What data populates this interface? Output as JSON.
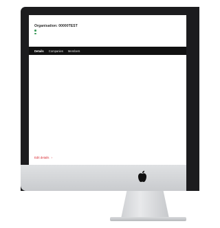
{
  "organisation": {
    "title": "Organisation: 00000TEST",
    "links": [
      "",
      ""
    ]
  },
  "tabs": [
    {
      "label": "Details",
      "active": true
    },
    {
      "label": "Companies",
      "active": false
    },
    {
      "label": "Members",
      "active": false
    },
    {
      "label": "",
      "active": false
    }
  ],
  "details": [
    {
      "label": "",
      "value": ""
    },
    {
      "label": "",
      "value": ""
    },
    {
      "label": "",
      "value": ""
    },
    {
      "label": "",
      "value": ""
    },
    {
      "label": "",
      "value": ""
    },
    {
      "label": "",
      "value": ""
    },
    {
      "label": "",
      "value": ""
    },
    {
      "label": "",
      "value": ""
    },
    {
      "label": "",
      "value": ""
    },
    {
      "label": "",
      "value": ""
    },
    {
      "label": "",
      "value": ""
    }
  ],
  "actions": {
    "edit_label": "Edit details",
    "edit_icon": "chevron-right-icon"
  },
  "colors": {
    "link_green": "#3a9a5a",
    "tabbar_bg": "#111111",
    "accent_red": "#d9262e"
  },
  "device": {
    "logo": "apple-logo-icon"
  }
}
